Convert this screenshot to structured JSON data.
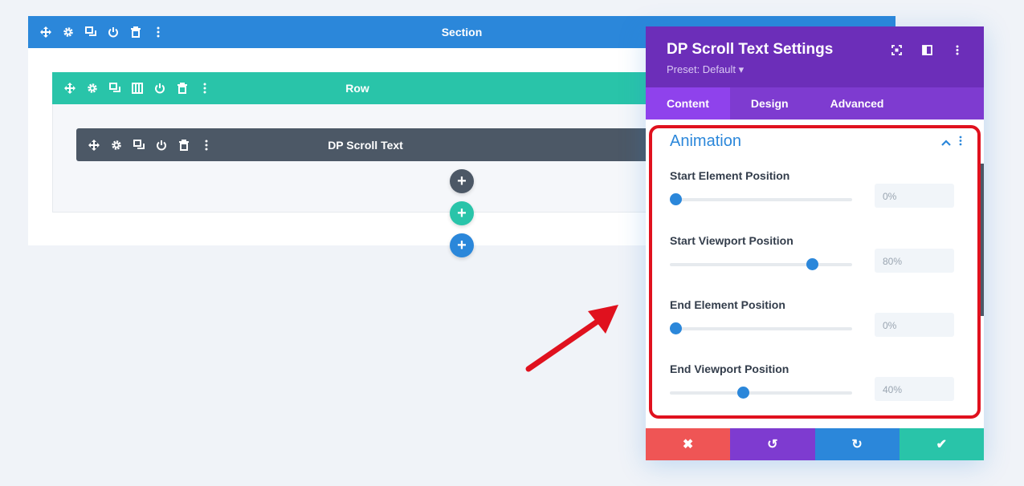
{
  "section": {
    "label": "Section"
  },
  "row": {
    "label": "Row"
  },
  "module": {
    "label": "DP Scroll Text"
  },
  "add_buttons": {
    "module": "+",
    "row": "+",
    "section": "+"
  },
  "modal": {
    "title": "DP Scroll Text Settings",
    "preset": "Preset: Default ▾",
    "tabs": [
      {
        "label": "Content",
        "active": true
      },
      {
        "label": "Design",
        "active": false
      },
      {
        "label": "Advanced",
        "active": false
      }
    ],
    "group": {
      "title": "Animation",
      "fields": [
        {
          "label": "Start Element Position",
          "value": "0%",
          "fraction": 0.03
        },
        {
          "label": "Start Viewport Position",
          "value": "80%",
          "fraction": 0.78
        },
        {
          "label": "End Element Position",
          "value": "0%",
          "fraction": 0.03
        },
        {
          "label": "End Viewport Position",
          "value": "40%",
          "fraction": 0.4
        }
      ]
    },
    "footer": {
      "cancel": "✖",
      "undo": "↺",
      "redo": "↻",
      "save": "✔"
    }
  },
  "colors": {
    "section": "#2b87da",
    "row": "#29c4a9",
    "module": "#4c5866",
    "modal_header": "#6c2eb9",
    "tabs": "#7e3bd0",
    "highlight": "#e0111e"
  }
}
